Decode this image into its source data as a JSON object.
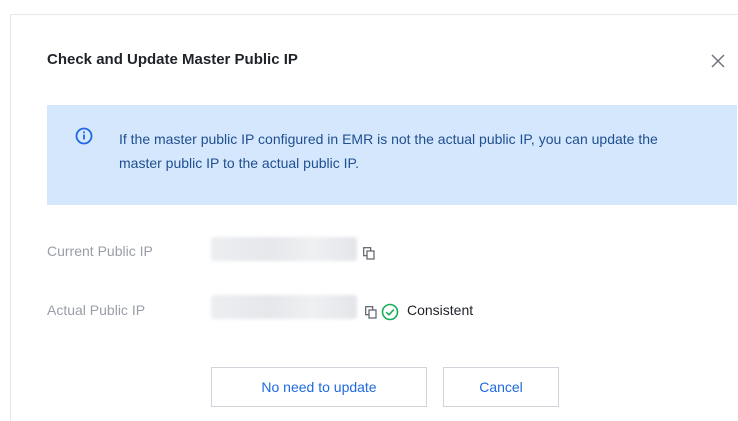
{
  "dialog": {
    "title": "Check and Update Master Public IP",
    "close_icon": "close-icon"
  },
  "notice": {
    "icon": "info-icon",
    "text": "If the master public IP configured in EMR is not the actual public IP, you can update the master public IP to the actual public IP."
  },
  "fields": {
    "current_label": "Current Public IP",
    "actual_label": "Actual Public IP",
    "status_text": "Consistent"
  },
  "buttons": {
    "no_update": "No need to update",
    "cancel": "Cancel"
  },
  "colors": {
    "accent": "#1e6ae0",
    "success": "#1aad5c",
    "notice_bg": "#d5e7fd"
  }
}
